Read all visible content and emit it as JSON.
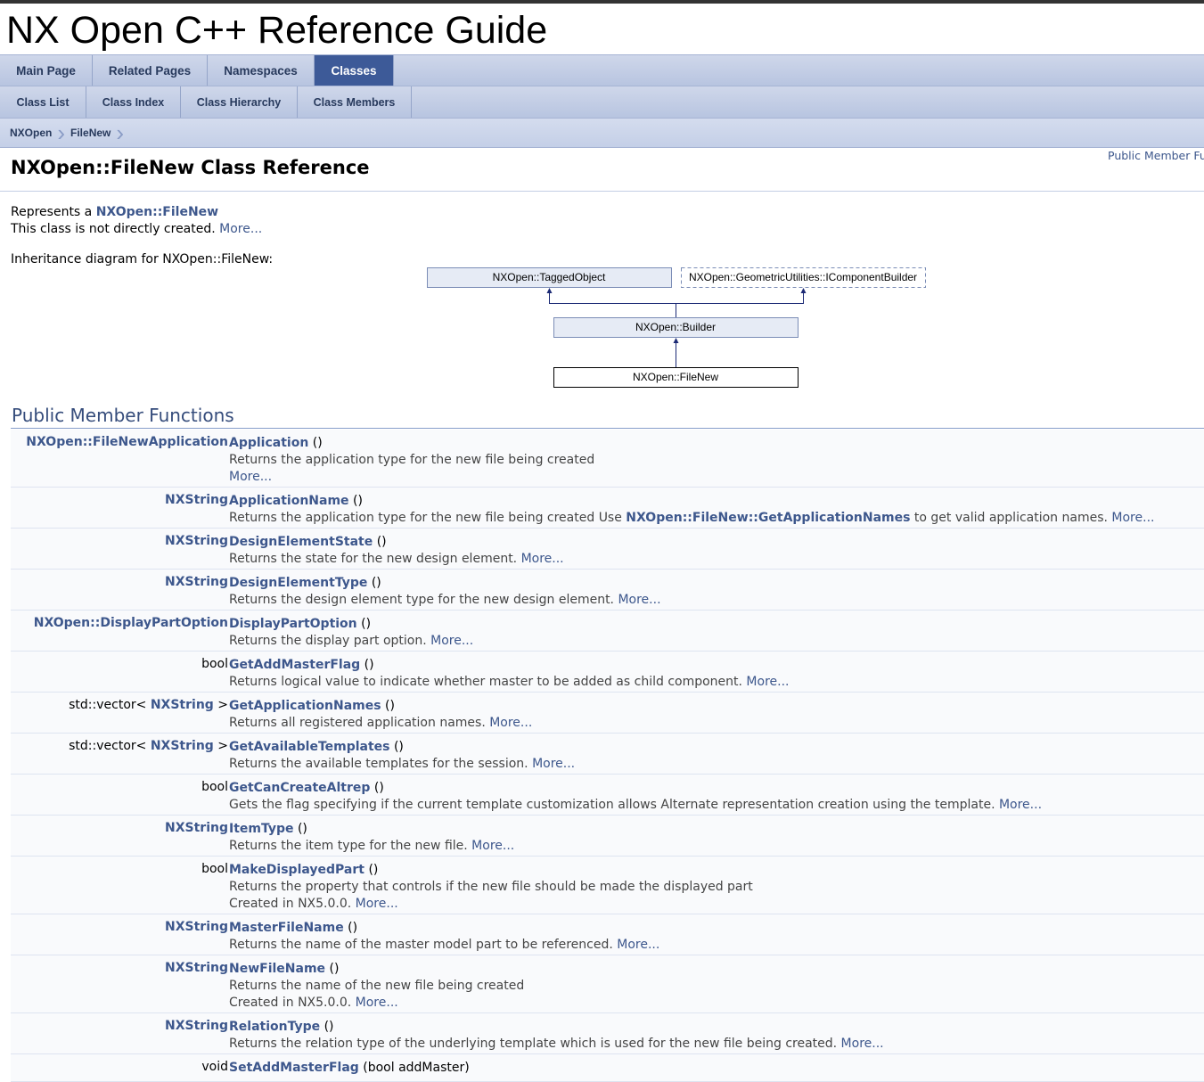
{
  "site_title": "NX Open C++ Reference Guide",
  "main_tabs": [
    {
      "label": "Main Page",
      "active": false
    },
    {
      "label": "Related Pages",
      "active": false
    },
    {
      "label": "Namespaces",
      "active": false
    },
    {
      "label": "Classes",
      "active": true
    }
  ],
  "sub_tabs": [
    {
      "label": "Class List"
    },
    {
      "label": "Class Index"
    },
    {
      "label": "Class Hierarchy"
    },
    {
      "label": "Class Members"
    }
  ],
  "breadcrumb": [
    {
      "label": "NXOpen"
    },
    {
      "label": "FileNew"
    }
  ],
  "summary_link": "Public Member Fur",
  "page_title": "NXOpen::FileNew Class Reference",
  "description": {
    "represents_prefix": "Represents a ",
    "represents_link": "NXOpen::FileNew",
    "not_created": "This class is not directly created.",
    "more": "More...",
    "inheritance_label": "Inheritance diagram for NXOpen::FileNew:"
  },
  "inheritance": {
    "tagged_object": "NXOpen::TaggedObject",
    "component_builder": "NXOpen::GeometricUtilities::IComponentBuilder",
    "builder": "NXOpen::Builder",
    "file_new": "NXOpen::FileNew"
  },
  "section_title": "Public Member Functions",
  "members": [
    {
      "type_pre": "",
      "type_link": "NXOpen::FileNewApplication",
      "type_post": "",
      "name": "Application",
      "args": "()",
      "desc": [
        [
          "Returns the application type for the new file being created"
        ],
        [
          "",
          "More..."
        ]
      ]
    },
    {
      "type_pre": "",
      "type_link": "NXString",
      "type_post": "",
      "name": "ApplicationName",
      "args": "()",
      "desc": [
        [
          "Returns the application type for the new file being created Use ",
          "",
          "NXOpen::FileNew::GetApplicationNames",
          " to get valid application names. ",
          "More..."
        ]
      ]
    },
    {
      "type_pre": "",
      "type_link": "NXString",
      "type_post": "",
      "name": "DesignElementState",
      "args": "()",
      "desc": [
        [
          "Returns the state for the new design element. ",
          "More..."
        ]
      ]
    },
    {
      "type_pre": "",
      "type_link": "NXString",
      "type_post": "",
      "name": "DesignElementType",
      "args": "()",
      "desc": [
        [
          "Returns the design element type for the new design element. ",
          "More..."
        ]
      ]
    },
    {
      "type_pre": "",
      "type_link": "NXOpen::DisplayPartOption",
      "type_post": "",
      "name": "DisplayPartOption",
      "args": "()",
      "desc": [
        [
          "Returns the display part option. ",
          "More..."
        ]
      ]
    },
    {
      "type_pre": "bool",
      "type_link": "",
      "type_post": "",
      "name": "GetAddMasterFlag",
      "args": "()",
      "desc": [
        [
          "Returns logical value to indicate whether master to be added as child component. ",
          "More..."
        ]
      ]
    },
    {
      "type_pre": "std::vector< ",
      "type_link": "NXString",
      "type_post": " >",
      "name": "GetApplicationNames",
      "args": "()",
      "desc": [
        [
          "Returns all registered application names. ",
          "More..."
        ]
      ]
    },
    {
      "type_pre": "std::vector< ",
      "type_link": "NXString",
      "type_post": " >",
      "name": "GetAvailableTemplates",
      "args": "()",
      "desc": [
        [
          "Returns the available templates for the session. ",
          "More..."
        ]
      ]
    },
    {
      "type_pre": "bool",
      "type_link": "",
      "type_post": "",
      "name": "GetCanCreateAltrep",
      "args": "()",
      "desc": [
        [
          "Gets the flag specifying if the current template customization allows Alternate representation creation using the template. ",
          "More..."
        ]
      ]
    },
    {
      "type_pre": "",
      "type_link": "NXString",
      "type_post": "",
      "name": "ItemType",
      "args": "()",
      "desc": [
        [
          "Returns the item type for the new file. ",
          "More..."
        ]
      ]
    },
    {
      "type_pre": "bool",
      "type_link": "",
      "type_post": "",
      "name": "MakeDisplayedPart",
      "args": "()",
      "desc": [
        [
          "Returns the property that controls if the new file should be made the displayed part"
        ],
        [
          "Created in NX5.0.0. ",
          "More..."
        ]
      ]
    },
    {
      "type_pre": "",
      "type_link": "NXString",
      "type_post": "",
      "name": "MasterFileName",
      "args": "()",
      "desc": [
        [
          "Returns the name of the master model part to be referenced. ",
          "More..."
        ]
      ]
    },
    {
      "type_pre": "",
      "type_link": "NXString",
      "type_post": "",
      "name": "NewFileName",
      "args": "()",
      "desc": [
        [
          "Returns the name of the new file being created"
        ],
        [
          "Created in NX5.0.0. ",
          "More..."
        ]
      ]
    },
    {
      "type_pre": "",
      "type_link": "NXString",
      "type_post": "",
      "name": "RelationType",
      "args": "()",
      "desc": [
        [
          "Returns the relation type of the underlying template which is used for the new file being created. ",
          "More..."
        ]
      ]
    },
    {
      "type_pre": "void",
      "type_link": "",
      "type_post": "",
      "name": "SetAddMasterFlag",
      "args": "(bool addMaster)",
      "desc": []
    }
  ]
}
